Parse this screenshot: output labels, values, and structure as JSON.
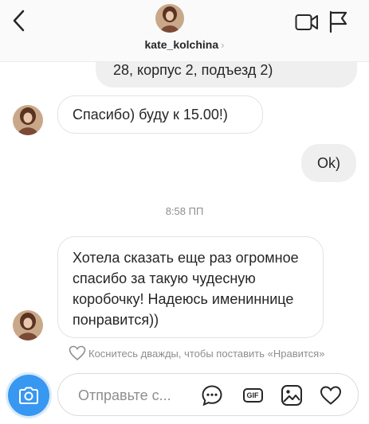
{
  "header": {
    "username": "kate_kolchina",
    "chevron": "›",
    "icons": {
      "back": "chevron-left-icon",
      "video": "video-call-icon",
      "flag": "flag-icon"
    }
  },
  "messages": {
    "partial_outgoing": "28, корпус 2, подъезд 2)",
    "incoming_thanks": "Спасибо) буду к 15.00!)",
    "outgoing_ok": "Ok)",
    "timestamp": "8:58 ПП",
    "incoming_long": "Хотела сказать еще раз огромное спасибо за такую чудесную коробочку! Надеюсь имениннице понравится))"
  },
  "like_hint": "Коснитесь дважды, чтобы поставить «Нравится»",
  "composer": {
    "placeholder": "Отправьте с...",
    "gif_label": "GIF",
    "icons": [
      "camera-icon",
      "more-icon",
      "gif-icon",
      "image-icon",
      "heart-icon"
    ]
  },
  "colors": {
    "accent": "#3897f0",
    "bubble_gray": "#efefef",
    "muted_text": "#8e8e8e"
  }
}
